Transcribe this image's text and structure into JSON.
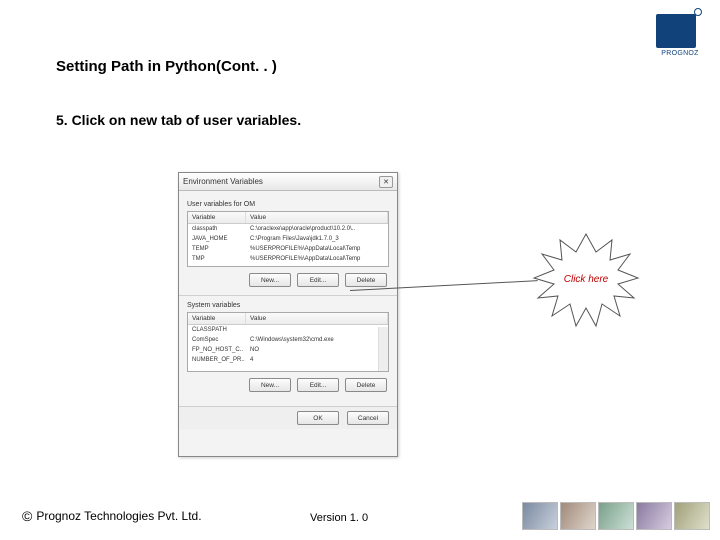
{
  "logo": {
    "brand": "PROGNOZ"
  },
  "slide": {
    "title": "Setting Path in Python(Cont. . )",
    "step": "5. Click on new tab of user variables."
  },
  "dialog": {
    "title": "Environment Variables",
    "user_section_label": "User variables for OM",
    "sys_section_label": "System variables",
    "headers": {
      "variable": "Variable",
      "value": "Value"
    },
    "user_rows": [
      {
        "var": "classpath",
        "val": "C:\\oraclexe\\app\\oracle\\product\\10.2.0\\.."
      },
      {
        "var": "JAVA_HOME",
        "val": "C:\\Program Files\\Java\\jdk1.7.0_3"
      },
      {
        "var": "TEMP",
        "val": "%USERPROFILE%\\AppData\\Local\\Temp"
      },
      {
        "var": "TMP",
        "val": "%USERPROFILE%\\AppData\\Local\\Temp"
      }
    ],
    "sys_rows": [
      {
        "var": "CLASSPATH",
        "val": ""
      },
      {
        "var": "ComSpec",
        "val": "C:\\Windows\\system32\\cmd.exe"
      },
      {
        "var": "FP_NO_HOST_C..",
        "val": "NO"
      },
      {
        "var": "NUMBER_OF_PR..",
        "val": "4"
      }
    ],
    "buttons": {
      "new": "New...",
      "edit": "Edit...",
      "delete": "Delete"
    },
    "ok": "OK",
    "cancel": "Cancel"
  },
  "callout": {
    "label": "Click here"
  },
  "footer": {
    "left": "Prognoz Technologies Pvt. Ltd.",
    "version": "Version 1. 0"
  }
}
